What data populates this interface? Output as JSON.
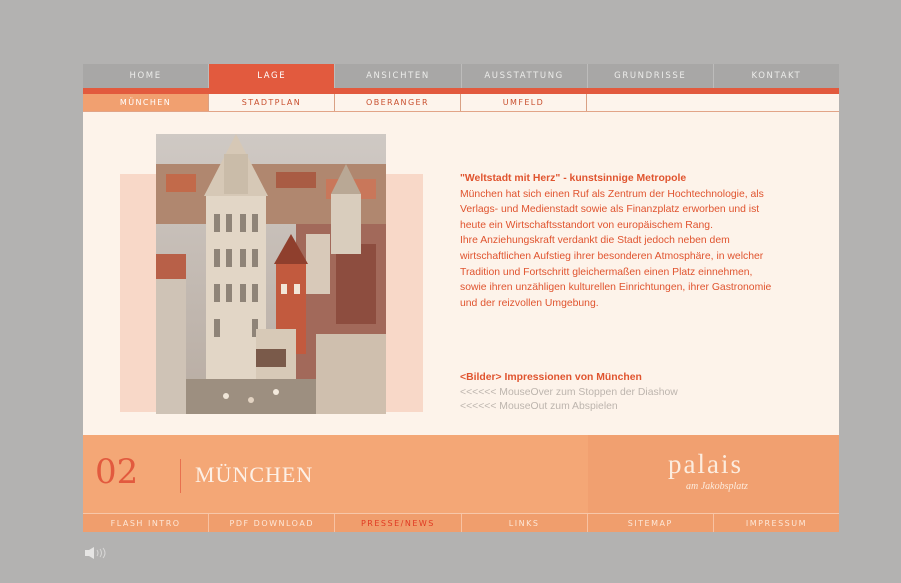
{
  "topnav": [
    "HOME",
    "LAGE",
    "ANSICHTEN",
    "AUSSTATTUNG",
    "GRUNDRISSE",
    "KONTAKT"
  ],
  "topnav_active": "LAGE",
  "subnav": [
    "MÜNCHEN",
    "STADTPLAN",
    "OBERANGER",
    "UMFELD"
  ],
  "subnav_active": "MÜNCHEN",
  "article": {
    "headline": "\"Weltstadt mit Herz\" - kunstsinnige Metropole",
    "lines": [
      "München hat sich einen Ruf als Zentrum der Hochtechnologie, als",
      "Verlags- und Medienstadt sowie als Finanzplatz erworben und ist",
      "heute ein Wirtschaftsstandort von europäischem Rang.",
      "Ihre Anziehungskraft verdankt die Stadt jedoch neben dem",
      "wirtschaftlichen Aufstieg ihrer besonderen Atmosphäre, in welcher",
      "Tradition und Fortschritt gleichermaßen einen Platz einnehmen,",
      "sowie ihren unzähligen kulturellen Einrichtungen, ihrer Gastronomie",
      "und der reizvollen Umgebung."
    ]
  },
  "gallery": {
    "headline": "<Bilder> Impressionen von München",
    "hint1": "<<<<<< MouseOver zum Stoppen der Diashow",
    "hint2": "<<<<<< MouseOut zum Abspielen"
  },
  "banner": {
    "number": "02",
    "title": "MÜNCHEN",
    "logo": "palais",
    "logo_sub": "am Jakobsplatz"
  },
  "botnav": [
    "FLASH INTRO",
    "PDF DOWNLOAD",
    "PRESSE/NEWS",
    "LINKS",
    "SITEMAP",
    "IMPRESSUM"
  ],
  "botnav_highlight": "PRESSE/NEWS",
  "icons": {
    "sound": "speaker-icon",
    "photo": "munich-townhall-photo"
  },
  "colors": {
    "accent": "#e25a3e",
    "text": "#e0542f",
    "banner": "#f4a776",
    "background": "#b3b2b1"
  }
}
